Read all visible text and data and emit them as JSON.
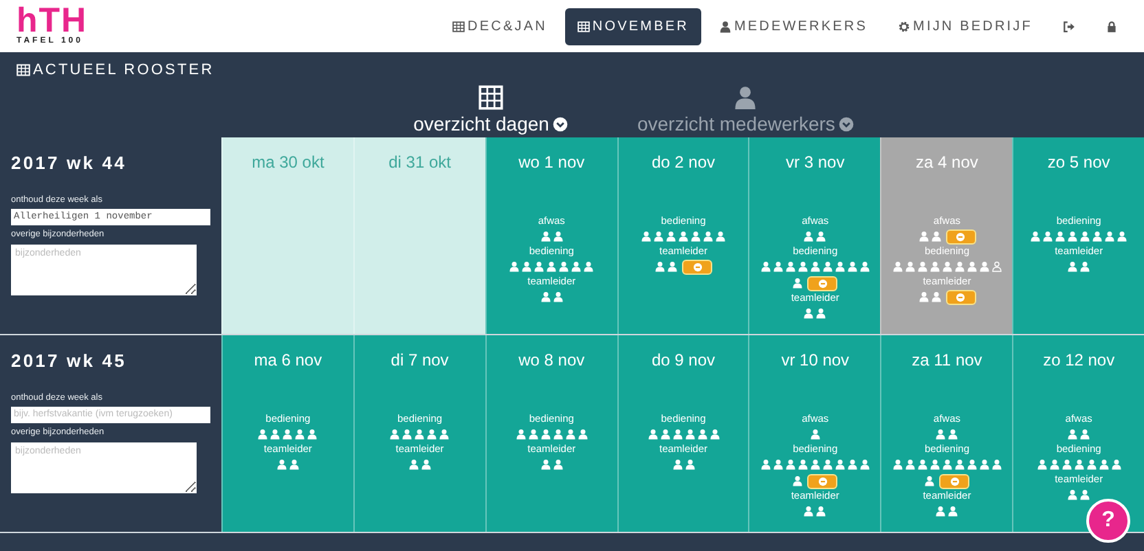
{
  "logo": {
    "mark": "hTH",
    "subtitle": "TAFEL 100"
  },
  "nav": [
    {
      "kind": "calendar",
      "label": "DEC&JAN",
      "selected": false
    },
    {
      "kind": "calendar",
      "label": "NOVEMBER",
      "selected": true
    },
    {
      "kind": "person",
      "label": "MEDEWERKERS",
      "selected": false
    },
    {
      "kind": "gear",
      "label": "MIJN BEDRIJF",
      "selected": false
    },
    {
      "kind": "exit",
      "selected": false
    },
    {
      "kind": "lock",
      "selected": false
    }
  ],
  "section_title": "ACTUEEL ROOSTER",
  "views": [
    {
      "kind": "grid",
      "label": "overzicht dagen",
      "selected": true
    },
    {
      "kind": "person",
      "label": "overzicht medewerkers",
      "selected": false
    }
  ],
  "weeks": [
    {
      "title": "2017 wk 44",
      "name_label": "onthoud deze week als",
      "name_value": "Allerheiligen 1 november",
      "notes_label": "overige bijzonderheden",
      "notes_placeholder": "bijzonderheden",
      "days": [
        {
          "label": "ma 30 okt",
          "kind": "past"
        },
        {
          "label": "di 31 okt",
          "kind": "past"
        },
        {
          "label": "wo 1 nov",
          "kind": "normal",
          "groups": [
            {
              "role": "afwas",
              "lines": [
                [
                  {
                    "kind": "person"
                  },
                  {
                    "kind": "person"
                  }
                ]
              ]
            },
            {
              "role": "bediening",
              "lines": [
                [
                  {
                    "kind": "person"
                  },
                  {
                    "kind": "person"
                  },
                  {
                    "kind": "person"
                  },
                  {
                    "kind": "person"
                  },
                  {
                    "kind": "person"
                  },
                  {
                    "kind": "person"
                  },
                  {
                    "kind": "person"
                  }
                ]
              ]
            },
            {
              "role": "teamleider",
              "lines": [
                [
                  {
                    "kind": "person"
                  },
                  {
                    "kind": "person"
                  }
                ]
              ]
            }
          ]
        },
        {
          "label": "do 2 nov",
          "kind": "normal",
          "groups": [
            {
              "role": "bediening",
              "lines": [
                [
                  {
                    "kind": "person"
                  },
                  {
                    "kind": "person"
                  },
                  {
                    "kind": "person"
                  },
                  {
                    "kind": "person"
                  },
                  {
                    "kind": "person"
                  },
                  {
                    "kind": "person"
                  },
                  {
                    "kind": "person"
                  }
                ]
              ]
            },
            {
              "role": "teamleider",
              "lines": [
                [
                  {
                    "kind": "person"
                  },
                  {
                    "kind": "person"
                  },
                  {
                    "kind": "open"
                  }
                ]
              ]
            }
          ]
        },
        {
          "label": "vr 3 nov",
          "kind": "normal",
          "groups": [
            {
              "role": "afwas",
              "lines": [
                [
                  {
                    "kind": "person"
                  },
                  {
                    "kind": "person"
                  }
                ]
              ]
            },
            {
              "role": "bediening",
              "lines": [
                [
                  {
                    "kind": "person"
                  },
                  {
                    "kind": "person"
                  },
                  {
                    "kind": "person"
                  },
                  {
                    "kind": "person"
                  },
                  {
                    "kind": "person"
                  },
                  {
                    "kind": "person"
                  },
                  {
                    "kind": "person"
                  },
                  {
                    "kind": "person"
                  },
                  {
                    "kind": "person"
                  }
                ],
                [
                  {
                    "kind": "person"
                  },
                  {
                    "kind": "open"
                  }
                ]
              ]
            },
            {
              "role": "teamleider",
              "lines": [
                [
                  {
                    "kind": "person"
                  },
                  {
                    "kind": "person"
                  }
                ]
              ]
            }
          ]
        },
        {
          "label": "za 4 nov",
          "kind": "marked",
          "groups": [
            {
              "role": "afwas",
              "lines": [
                [
                  {
                    "kind": "person"
                  },
                  {
                    "kind": "person"
                  },
                  {
                    "kind": "open"
                  }
                ]
              ]
            },
            {
              "role": "bediening",
              "lines": [
                [
                  {
                    "kind": "person"
                  },
                  {
                    "kind": "person"
                  },
                  {
                    "kind": "person"
                  },
                  {
                    "kind": "person"
                  },
                  {
                    "kind": "person"
                  },
                  {
                    "kind": "person"
                  },
                  {
                    "kind": "person"
                  },
                  {
                    "kind": "person"
                  },
                  {
                    "kind": "vacant"
                  }
                ]
              ]
            },
            {
              "role": "teamleider",
              "lines": [
                [
                  {
                    "kind": "person"
                  },
                  {
                    "kind": "person"
                  },
                  {
                    "kind": "open"
                  }
                ]
              ]
            }
          ]
        },
        {
          "label": "zo 5 nov",
          "kind": "normal",
          "groups": [
            {
              "role": "bediening",
              "lines": [
                [
                  {
                    "kind": "person"
                  },
                  {
                    "kind": "person"
                  },
                  {
                    "kind": "person"
                  },
                  {
                    "kind": "person"
                  },
                  {
                    "kind": "person"
                  },
                  {
                    "kind": "person"
                  },
                  {
                    "kind": "person"
                  },
                  {
                    "kind": "person"
                  }
                ]
              ]
            },
            {
              "role": "teamleider",
              "lines": [
                [
                  {
                    "kind": "person"
                  },
                  {
                    "kind": "person"
                  }
                ]
              ]
            }
          ]
        }
      ]
    },
    {
      "title": "2017 wk 45",
      "name_label": "onthoud deze week als",
      "name_placeholder": "bijv. herfstvakantie (ivm terugzoeken)",
      "notes_label": "overige bijzonderheden",
      "notes_placeholder": "bijzonderheden",
      "days": [
        {
          "label": "ma 6 nov",
          "kind": "normal",
          "groups": [
            {
              "role": "bediening",
              "lines": [
                [
                  {
                    "kind": "person"
                  },
                  {
                    "kind": "person"
                  },
                  {
                    "kind": "person"
                  },
                  {
                    "kind": "person"
                  },
                  {
                    "kind": "person"
                  }
                ]
              ]
            },
            {
              "role": "teamleider",
              "lines": [
                [
                  {
                    "kind": "person"
                  },
                  {
                    "kind": "person"
                  }
                ]
              ]
            }
          ]
        },
        {
          "label": "di 7 nov",
          "kind": "normal",
          "groups": [
            {
              "role": "bediening",
              "lines": [
                [
                  {
                    "kind": "person"
                  },
                  {
                    "kind": "person"
                  },
                  {
                    "kind": "person"
                  },
                  {
                    "kind": "person"
                  },
                  {
                    "kind": "person"
                  }
                ]
              ]
            },
            {
              "role": "teamleider",
              "lines": [
                [
                  {
                    "kind": "person"
                  },
                  {
                    "kind": "person"
                  }
                ]
              ]
            }
          ]
        },
        {
          "label": "wo 8 nov",
          "kind": "normal",
          "groups": [
            {
              "role": "bediening",
              "lines": [
                [
                  {
                    "kind": "person"
                  },
                  {
                    "kind": "person"
                  },
                  {
                    "kind": "person"
                  },
                  {
                    "kind": "person"
                  },
                  {
                    "kind": "person"
                  },
                  {
                    "kind": "person"
                  }
                ]
              ]
            },
            {
              "role": "teamleider",
              "lines": [
                [
                  {
                    "kind": "person"
                  },
                  {
                    "kind": "person"
                  }
                ]
              ]
            }
          ]
        },
        {
          "label": "do 9 nov",
          "kind": "normal",
          "groups": [
            {
              "role": "bediening",
              "lines": [
                [
                  {
                    "kind": "person"
                  },
                  {
                    "kind": "person"
                  },
                  {
                    "kind": "person"
                  },
                  {
                    "kind": "person"
                  },
                  {
                    "kind": "person"
                  },
                  {
                    "kind": "person"
                  }
                ]
              ]
            },
            {
              "role": "teamleider",
              "lines": [
                [
                  {
                    "kind": "person"
                  },
                  {
                    "kind": "person"
                  }
                ]
              ]
            }
          ]
        },
        {
          "label": "vr 10 nov",
          "kind": "normal",
          "groups": [
            {
              "role": "afwas",
              "lines": [
                [
                  {
                    "kind": "person"
                  }
                ]
              ]
            },
            {
              "role": "bediening",
              "lines": [
                [
                  {
                    "kind": "person"
                  },
                  {
                    "kind": "person"
                  },
                  {
                    "kind": "person"
                  },
                  {
                    "kind": "person"
                  },
                  {
                    "kind": "person"
                  },
                  {
                    "kind": "person"
                  },
                  {
                    "kind": "person"
                  },
                  {
                    "kind": "person"
                  },
                  {
                    "kind": "person"
                  }
                ],
                [
                  {
                    "kind": "person"
                  },
                  {
                    "kind": "open"
                  }
                ]
              ]
            },
            {
              "role": "teamleider",
              "lines": [
                [
                  {
                    "kind": "person"
                  },
                  {
                    "kind": "person"
                  }
                ]
              ]
            }
          ]
        },
        {
          "label": "za 11 nov",
          "kind": "normal",
          "groups": [
            {
              "role": "afwas",
              "lines": [
                [
                  {
                    "kind": "person"
                  },
                  {
                    "kind": "person"
                  }
                ]
              ]
            },
            {
              "role": "bediening",
              "lines": [
                [
                  {
                    "kind": "person"
                  },
                  {
                    "kind": "person"
                  },
                  {
                    "kind": "person"
                  },
                  {
                    "kind": "person"
                  },
                  {
                    "kind": "person"
                  },
                  {
                    "kind": "person"
                  },
                  {
                    "kind": "person"
                  },
                  {
                    "kind": "person"
                  },
                  {
                    "kind": "person"
                  }
                ],
                [
                  {
                    "kind": "person"
                  },
                  {
                    "kind": "open"
                  }
                ]
              ]
            },
            {
              "role": "teamleider",
              "lines": [
                [
                  {
                    "kind": "person"
                  },
                  {
                    "kind": "person"
                  }
                ]
              ]
            }
          ]
        },
        {
          "label": "zo 12 nov",
          "kind": "normal",
          "groups": [
            {
              "role": "afwas",
              "lines": [
                [
                  {
                    "kind": "person"
                  },
                  {
                    "kind": "person"
                  }
                ]
              ]
            },
            {
              "role": "bediening",
              "lines": [
                [
                  {
                    "kind": "person"
                  },
                  {
                    "kind": "person"
                  },
                  {
                    "kind": "person"
                  },
                  {
                    "kind": "person"
                  },
                  {
                    "kind": "person"
                  },
                  {
                    "kind": "person"
                  },
                  {
                    "kind": "person"
                  }
                ]
              ]
            },
            {
              "role": "teamleider",
              "lines": [
                [
                  {
                    "kind": "person"
                  },
                  {
                    "kind": "person"
                  }
                ]
              ]
            }
          ]
        }
      ]
    }
  ],
  "help": "?"
}
